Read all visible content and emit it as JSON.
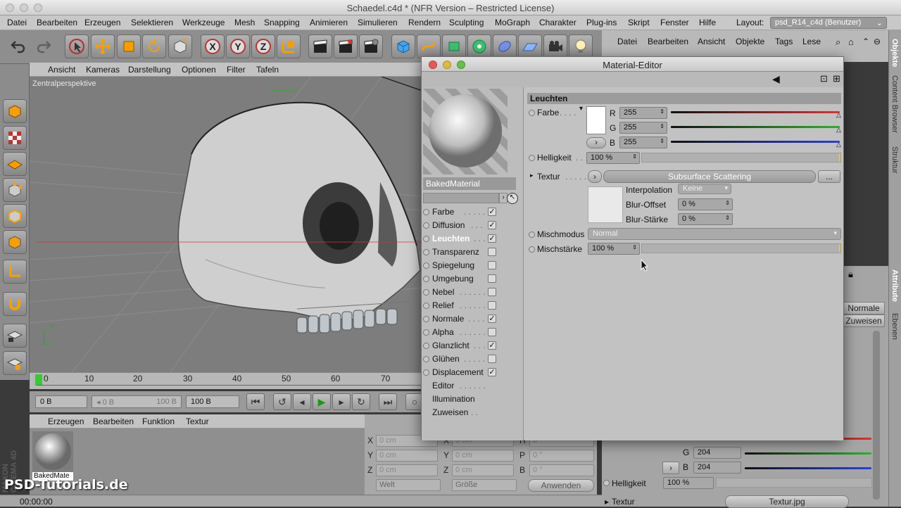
{
  "window": {
    "title": "Schaedel.c4d * (NFR Version – Restricted License)"
  },
  "menubar": [
    "Datei",
    "Bearbeiten",
    "Erzeugen",
    "Selektieren",
    "Werkzeuge",
    "Mesh",
    "Snapping",
    "Animieren",
    "Simulieren",
    "Rendern",
    "Sculpting",
    "MoGraph",
    "Charakter",
    "Plug-ins",
    "Skript",
    "Fenster",
    "Hilfe"
  ],
  "layout": {
    "label": "Layout:",
    "value": "psd_R14_c4d (Benutzer)"
  },
  "viewport": {
    "menu": [
      "Ansicht",
      "Kameras",
      "Darstellung",
      "Optionen",
      "Filter",
      "Tafeln"
    ],
    "label": "Zentralperspektive"
  },
  "timeline": {
    "ticks": [
      "0",
      "10",
      "20",
      "30",
      "40",
      "50",
      "60",
      "70"
    ]
  },
  "transport": {
    "start": "0 B",
    "range_left": "◂ 0 B",
    "range_right": "100 B",
    "end": "100 B"
  },
  "material_manager": {
    "menu": [
      "Erzeugen",
      "Bearbeiten",
      "Funktion",
      "Textur"
    ],
    "thumb_label": "BakedMate"
  },
  "coordinates": {
    "rows": [
      {
        "a": "X",
        "av": "0 cm",
        "b": "X",
        "bv": "0 cm",
        "c": "H",
        "cv": "0 °"
      },
      {
        "a": "Y",
        "av": "0 cm",
        "b": "Y",
        "bv": "0 cm",
        "c": "P",
        "cv": "0 °"
      },
      {
        "a": "Z",
        "av": "0 cm",
        "b": "Z",
        "bv": "0 cm",
        "c": "B",
        "cv": "0 °"
      }
    ],
    "mode1": "Welt",
    "mode2": "Größe",
    "apply": "Anwenden"
  },
  "status": {
    "time": "00:00:00"
  },
  "objects_panel": {
    "menu": [
      "Datei",
      "Bearbeiten",
      "Ansicht",
      "Objekte",
      "Tags",
      "Lese"
    ]
  },
  "side_tabs": [
    "Objekte",
    "Content Browser",
    "Struktur",
    "Attribute",
    "Ebenen"
  ],
  "attr_panel": {
    "btn1": "Normale",
    "btn2": "Zuweisen",
    "g_value": "204",
    "b_value": "204",
    "helligkeit_label": "Helligkeit",
    "helligkeit_value": "100 %",
    "textur_label": "Textur",
    "textur_value": "Textur.jpg"
  },
  "material_editor": {
    "title": "Material-Editor",
    "material_name": "BakedMaterial",
    "channels": [
      {
        "label": "Farbe",
        "checked": "✓"
      },
      {
        "label": "Diffusion",
        "checked": "✓"
      },
      {
        "label": "Leuchten",
        "checked": "✓"
      },
      {
        "label": "Transparenz",
        "checked": ""
      },
      {
        "label": "Spiegelung",
        "checked": ""
      },
      {
        "label": "Umgebung",
        "checked": ""
      },
      {
        "label": "Nebel",
        "checked": ""
      },
      {
        "label": "Relief",
        "checked": ""
      },
      {
        "label": "Normale",
        "checked": "✓"
      },
      {
        "label": "Alpha",
        "checked": ""
      },
      {
        "label": "Glanzlicht",
        "checked": "✓"
      },
      {
        "label": "Glühen",
        "checked": ""
      },
      {
        "label": "Displacement",
        "checked": "✓"
      }
    ],
    "extra": [
      "Editor",
      "Illumination",
      "Zuweisen"
    ],
    "section": "Leuchten",
    "farbe_label": "Farbe",
    "r_label": "R",
    "r_value": "255",
    "g_label": "G",
    "g_value": "255",
    "b_label": "B",
    "b_value": "255",
    "helligkeit_label": "Helligkeit",
    "helligkeit_value": "100 %",
    "textur_label": "Textur",
    "textur_shader": "Subsurface Scattering",
    "textur_more": "...",
    "interpolation_label": "Interpolation",
    "interpolation_value": "Keine",
    "blur_offset_label": "Blur-Offset",
    "blur_offset_value": "0 %",
    "blur_staerke_label": "Blur-Stärke",
    "blur_staerke_value": "0 %",
    "mischmodus_label": "Mischmodus",
    "mischmodus_value": "Normal",
    "mischstaerke_label": "Mischstärke",
    "mischstaerke_value": "100 %"
  },
  "watermark": {
    "logo": "PSD-Tutorials.de",
    "maxon": "MAXON CINEMA 4D"
  },
  "colors": {
    "red": "#e03030",
    "green": "#28b428",
    "blue": "#2840e0",
    "accent": "#f0c040"
  }
}
